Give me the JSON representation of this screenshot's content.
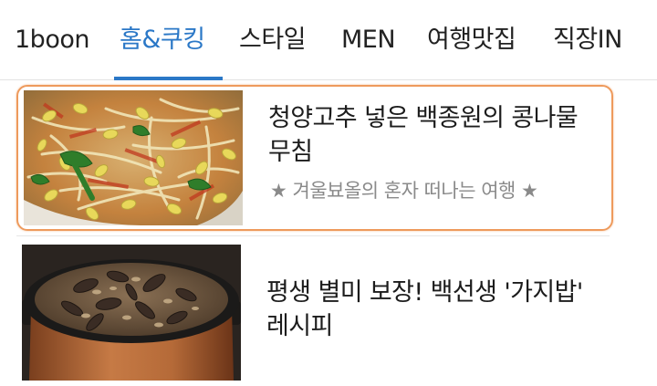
{
  "tabs": [
    {
      "label": "1boon",
      "active": false
    },
    {
      "label": "홈&쿠킹",
      "active": true
    },
    {
      "label": "스타일",
      "active": false
    },
    {
      "label": "MEN",
      "active": false
    },
    {
      "label": "여행맛집",
      "active": false
    },
    {
      "label": "직장IN",
      "active": false
    }
  ],
  "colors": {
    "active_tab": "#2b78c7",
    "highlight_border": "#ee9a5c",
    "subtitle": "#8a8a8a"
  },
  "articles": [
    {
      "title": "청양고추 넣은 백종원의 콩나물 무침",
      "subtitle": "★ 겨울뵤올의 혼자 떠나는 여행 ★",
      "thumbnail": "bean-sprout-salad-photo",
      "highlighted": true
    },
    {
      "title": "평생 별미 보장! 백선생 '가지밥' 레시피",
      "thumbnail": "eggplant-rice-pot-photo",
      "highlighted": false
    }
  ]
}
